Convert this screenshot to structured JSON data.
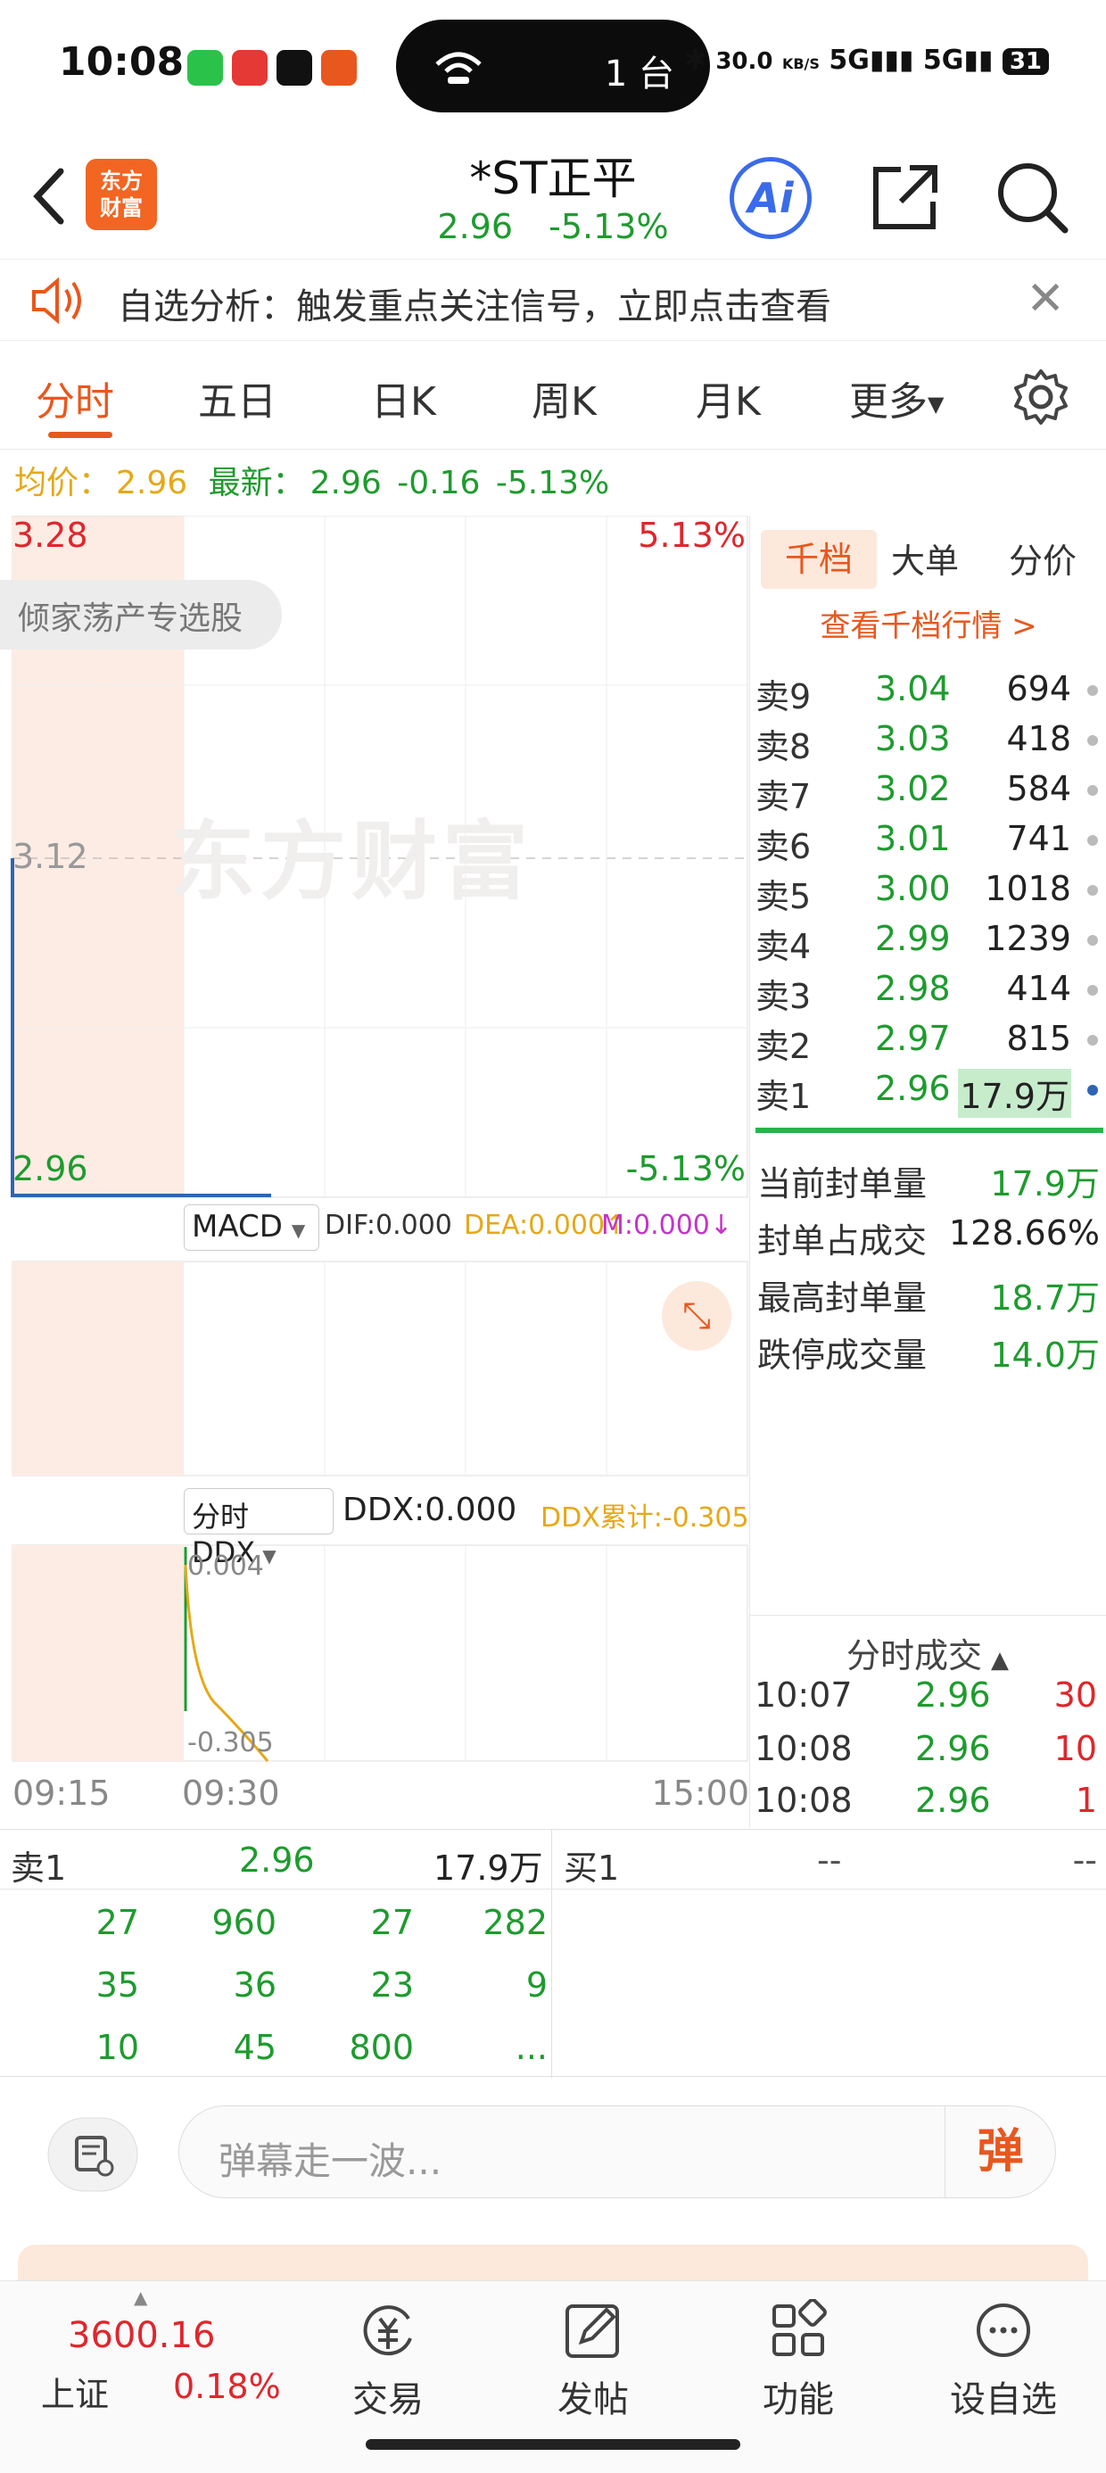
{
  "status_bar": {
    "time": "10:08",
    "island_text": "1 台",
    "network_speed": "30.0",
    "network_unit": "KB/S",
    "battery": "31"
  },
  "header": {
    "logo_text": "东方财富",
    "stock_name": "*ST正平",
    "price": "2.96",
    "change_pct": "-5.13%",
    "ai_label": "Ai"
  },
  "notice": {
    "text": "自选分析：触发重点关注信号，立即点击查看"
  },
  "tabs": [
    {
      "label": "分时"
    },
    {
      "label": "五日"
    },
    {
      "label": "日K"
    },
    {
      "label": "周K"
    },
    {
      "label": "月K"
    },
    {
      "label": "更多"
    }
  ],
  "info_line": {
    "avg_label": "均价：",
    "avg_value": "2.96",
    "latest_label": "最新：",
    "latest_value": "2.96",
    "change": "-0.16",
    "change_pct": "-5.13%"
  },
  "chart": {
    "y_top": "3.28",
    "y_mid": "3.12",
    "y_bottom": "2.96",
    "pct_top": "5.13%",
    "pct_bottom": "-5.13%",
    "sector_tag": "倾家荡产专选股",
    "watermark": "东方财富",
    "macd_selector": "MACD",
    "dif": "DIF:0.000",
    "dea": "DEA:0.000↑",
    "m": "M:0.000↓",
    "ddx_selector": "分时DDX",
    "ddx": "DDX:0.000",
    "ddx_cum": "DDX累计:-0.305",
    "ddx_top": "0.004",
    "ddx_bottom": "-0.305",
    "time_start": "09:15",
    "time_open": "09:30",
    "time_end": "15:00"
  },
  "orderbook": {
    "tabs": [
      "千档",
      "大单",
      "分价"
    ],
    "link": "查看千档行情 >",
    "asks": [
      {
        "label": "卖9",
        "price": "3.04",
        "vol": "694"
      },
      {
        "label": "卖8",
        "price": "3.03",
        "vol": "418"
      },
      {
        "label": "卖7",
        "price": "3.02",
        "vol": "584"
      },
      {
        "label": "卖6",
        "price": "3.01",
        "vol": "741"
      },
      {
        "label": "卖5",
        "price": "3.00",
        "vol": "1018"
      },
      {
        "label": "卖4",
        "price": "2.99",
        "vol": "1239"
      },
      {
        "label": "卖3",
        "price": "2.98",
        "vol": "414"
      },
      {
        "label": "卖2",
        "price": "2.97",
        "vol": "815"
      },
      {
        "label": "卖1",
        "price": "2.96",
        "vol": "17.9万"
      }
    ],
    "stats": [
      {
        "k": "当前封单量",
        "v": "17.9万"
      },
      {
        "k": "封单占成交",
        "v": "128.66%"
      },
      {
        "k": "最高封单量",
        "v": "18.7万"
      },
      {
        "k": "跌停成交量",
        "v": "14.0万"
      }
    ]
  },
  "trades": {
    "title": "分时成交",
    "rows": [
      {
        "time": "10:07",
        "price": "2.96",
        "vol": "30"
      },
      {
        "time": "10:08",
        "price": "2.96",
        "vol": "10"
      },
      {
        "time": "10:08",
        "price": "2.96",
        "vol": "1"
      }
    ]
  },
  "queue": {
    "sell_label": "卖1",
    "sell_price": "2.96",
    "sell_vol": "17.9万",
    "buy_label": "买1",
    "buy_price": "--",
    "buy_vol": "--",
    "cells": [
      "27",
      "960",
      "27",
      "282",
      "35",
      "36",
      "23",
      "9",
      "10",
      "45",
      "800",
      "..."
    ]
  },
  "comment": {
    "placeholder": "弹幕走一波...",
    "danmaku": "弹"
  },
  "bottom_nav": {
    "index_value": "3600.16",
    "index_name": "上证",
    "index_change": "0.18%",
    "items": [
      {
        "label": "交易"
      },
      {
        "label": "发帖"
      },
      {
        "label": "功能"
      },
      {
        "label": "设自选"
      }
    ]
  }
}
